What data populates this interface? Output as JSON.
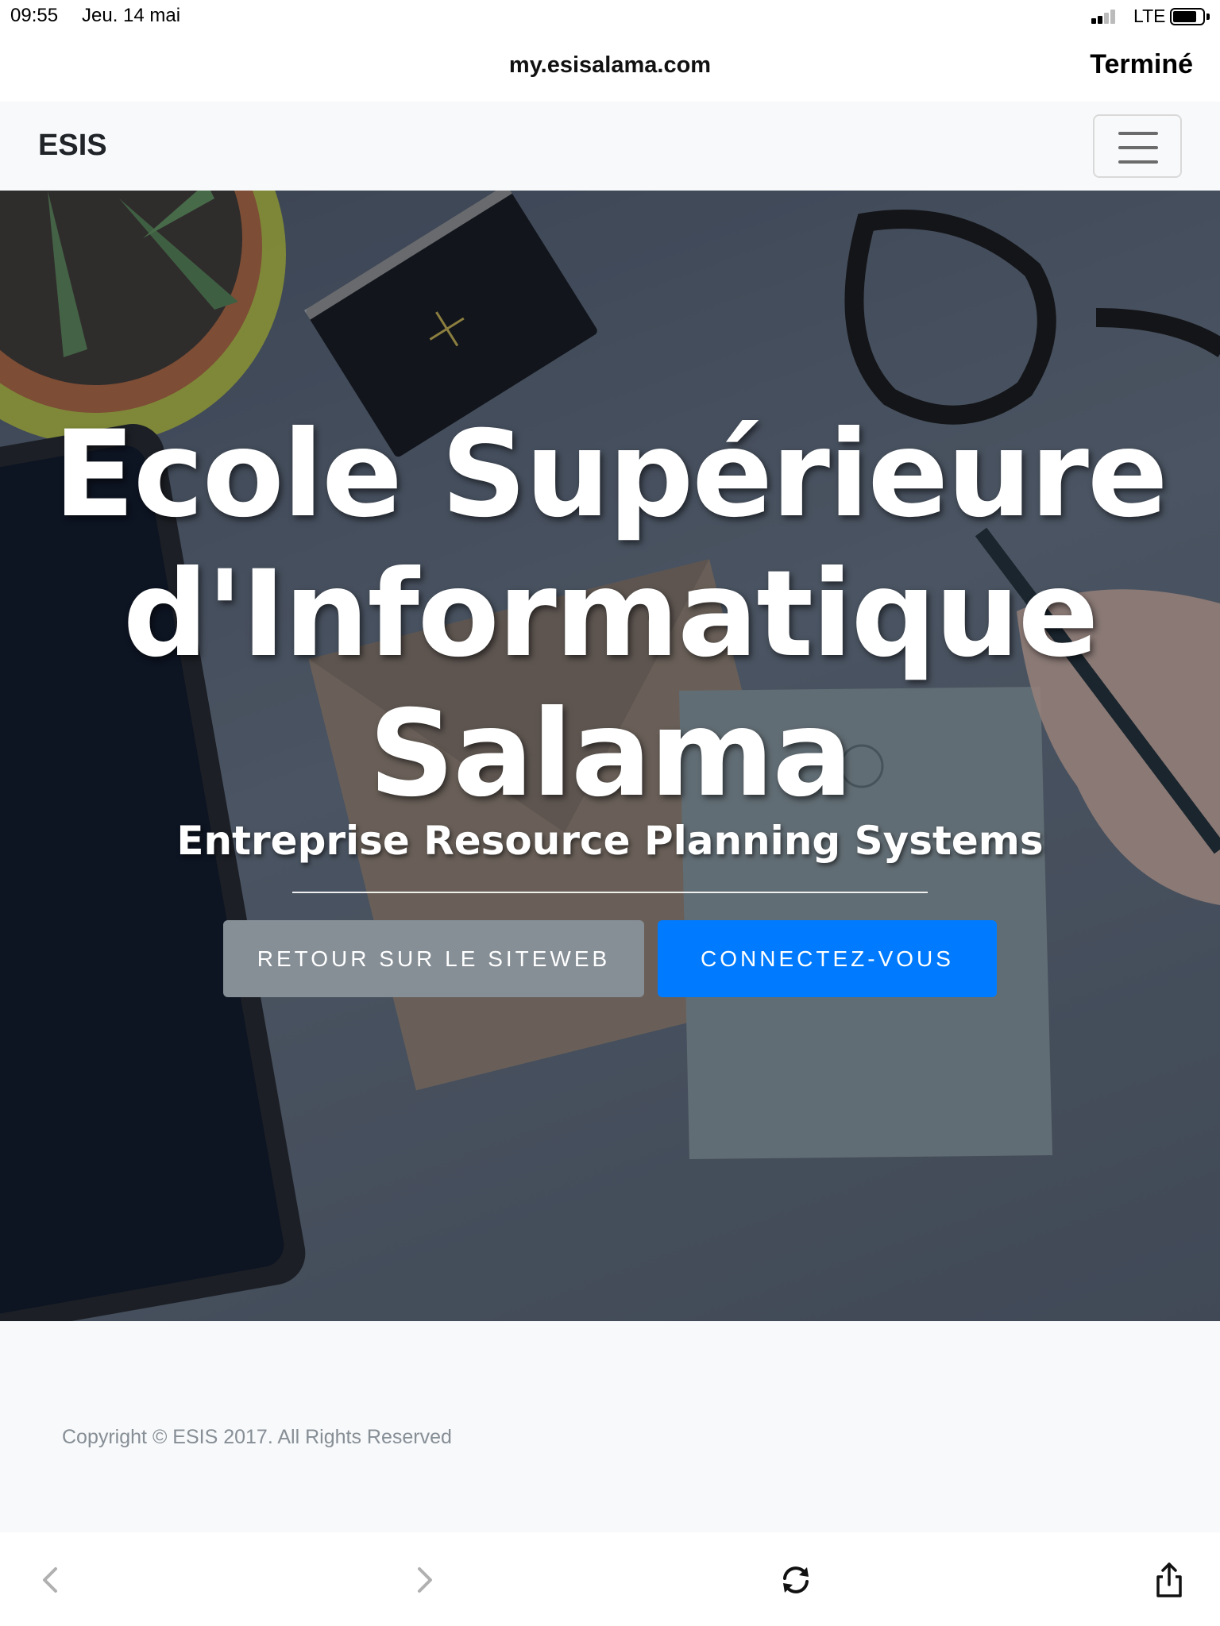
{
  "status_bar": {
    "time": "09:55",
    "date": "Jeu. 14 mai",
    "network": "LTE",
    "battery_level": 0.8
  },
  "browser": {
    "url": "my.esisalama.com",
    "done_label": "Terminé"
  },
  "navbar": {
    "brand": "ESIS",
    "menu_icon": "hamburger-icon"
  },
  "hero": {
    "title_line1": "Ecole Supérieure",
    "title_line2": "d'Informatique",
    "title_line3": "Salama",
    "subtitle": "Entreprise Resource Planning Systems",
    "secondary_button": "RETOUR SUR LE SITEWEB",
    "primary_button": "CONNECTEZ-VOUS"
  },
  "footer": {
    "copyright": "Copyright © ESIS 2017. All Rights Reserved"
  },
  "toolbar": {
    "icons": [
      "back-icon",
      "forward-icon",
      "reload-icon",
      "share-icon"
    ]
  },
  "colors": {
    "primary": "#007bff",
    "secondary": "#868e96",
    "navbar_bg": "#f8f9fa"
  }
}
